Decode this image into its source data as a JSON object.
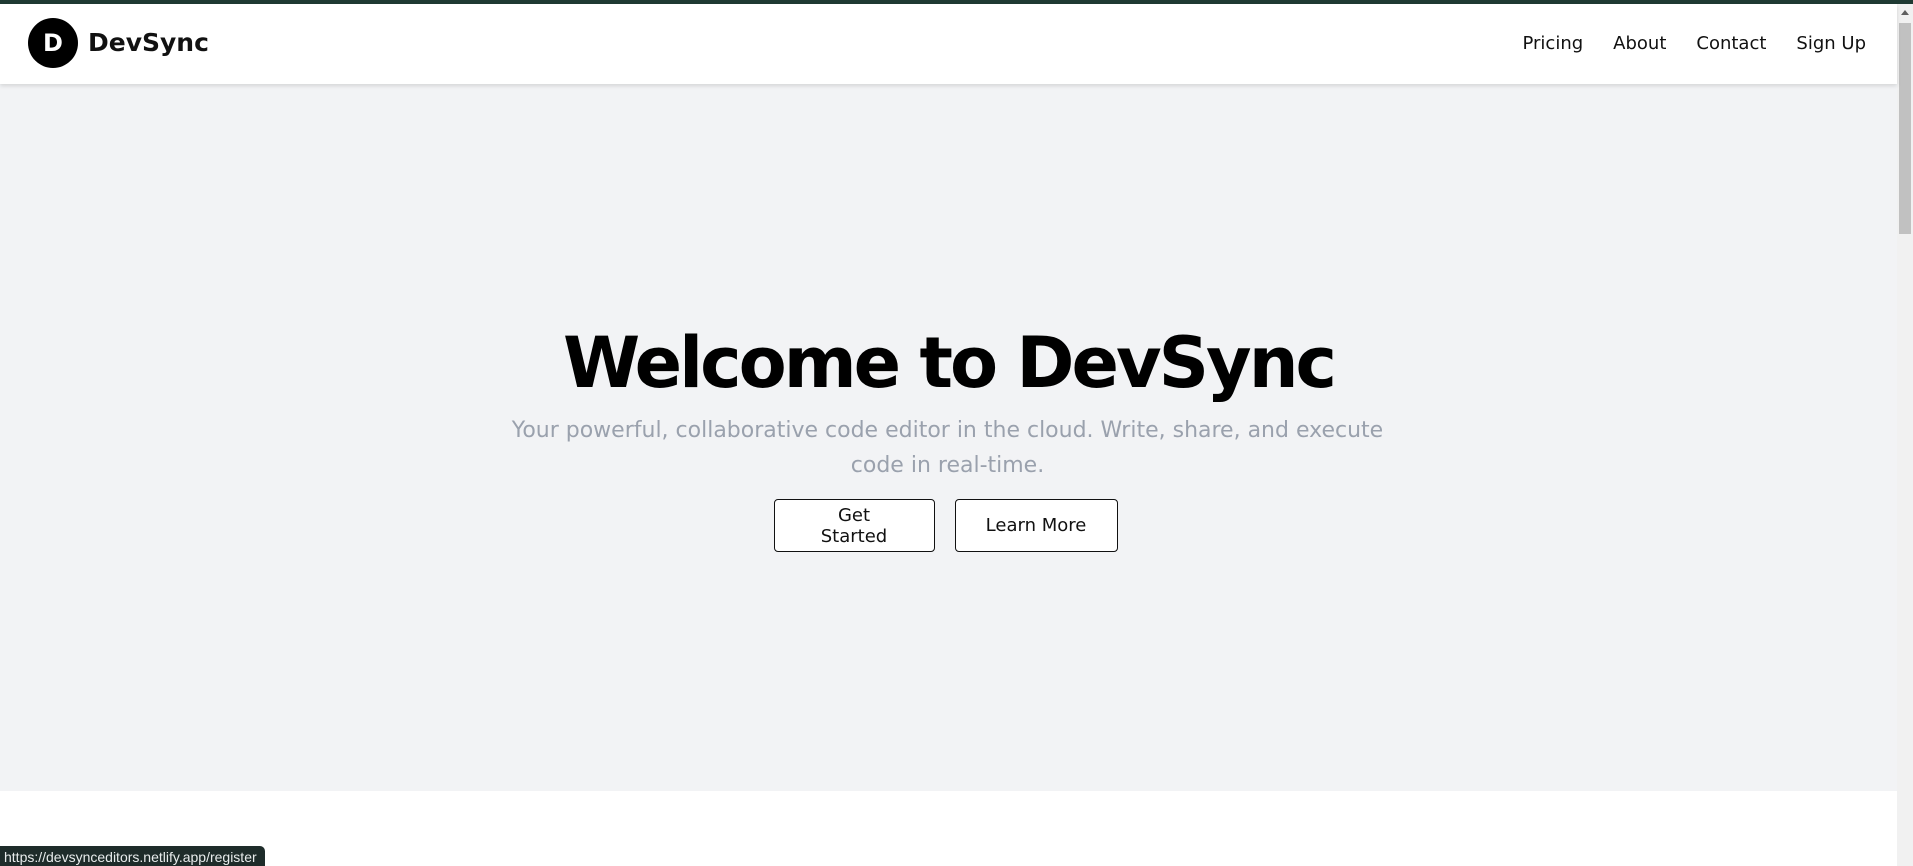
{
  "brand": {
    "logo_letter": "D",
    "name": "DevSync"
  },
  "nav": {
    "items": [
      {
        "label": "Pricing"
      },
      {
        "label": "About"
      },
      {
        "label": "Contact"
      },
      {
        "label": "Sign Up"
      }
    ]
  },
  "hero": {
    "title": "Welcome to DevSync",
    "subtitle": "Your powerful, collaborative code editor in the cloud. Write, share, and execute code in real-time.",
    "primary_button": "Get Started",
    "secondary_button": "Learn More"
  },
  "status_bar": {
    "url": "https://devsynceditors.netlify.app/register"
  },
  "scrollbar": {
    "up_arrow_icon": "triangle-up-icon"
  },
  "colors": {
    "top_strip": "#1f3a33",
    "hero_background": "#f2f3f5",
    "subtitle_text": "#9aa1ad",
    "logo_background": "#000000"
  }
}
